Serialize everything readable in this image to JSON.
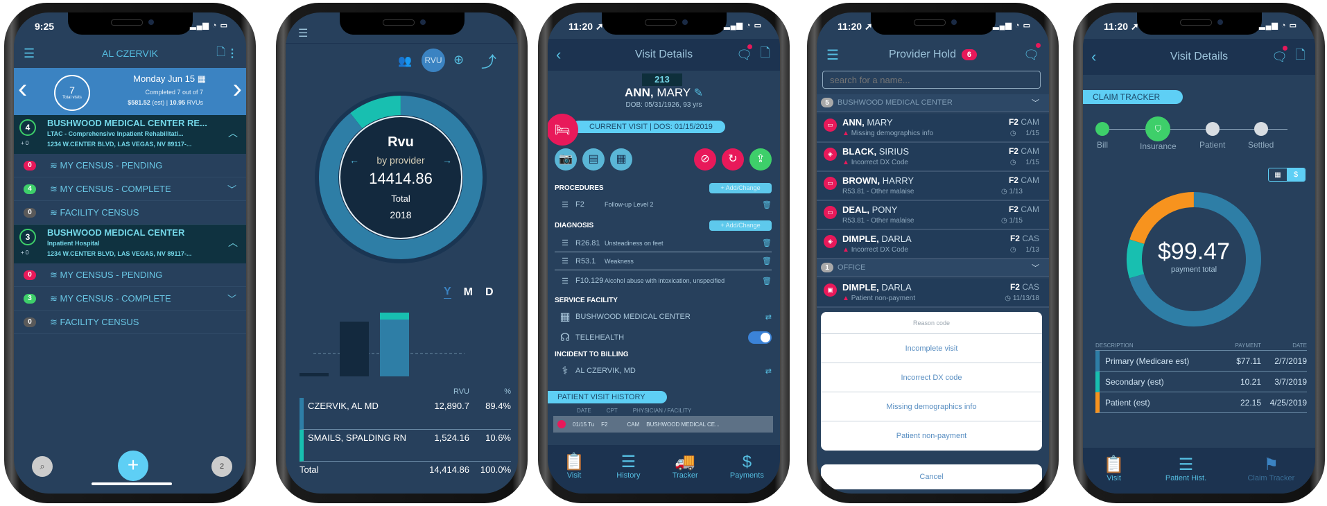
{
  "phone1": {
    "time": "9:25",
    "title": "AL CZERVIK",
    "hero": {
      "date": "Monday Jun 15",
      "visits_count": "7",
      "visits_label": "Total visits",
      "completed": "Completed 7 out of 7",
      "amount": "$581.52",
      "amount_suffix": "(est) |",
      "rvus": "10.95",
      "rvus_suffix": "RVUs"
    },
    "facilities": [
      {
        "count": "4",
        "plus": "+ 0",
        "name": "BUSHWOOD MEDICAL CENTER RE...",
        "type": "LTAC - Comprehensive Inpatient Rehabilitati...",
        "address": "1234 W.CENTER BLVD, LAS VEGAS, NV 89117-...",
        "items": [
          {
            "badge": "0",
            "label": "MY CENSUS - PENDING",
            "color": "#e8195a"
          },
          {
            "badge": "4",
            "label": "MY CENSUS - COMPLETE",
            "color": "#3ecf6a"
          },
          {
            "badge": "0",
            "label": "FACILITY CENSUS",
            "color": "#5a5a5a"
          }
        ]
      },
      {
        "count": "3",
        "plus": "+ 0",
        "name": "BUSHWOOD MEDICAL CENTER",
        "type": "Inpatient Hospital",
        "address": "1234 W.CENTER BLVD, LAS VEGAS, NV 89117-...",
        "items": [
          {
            "badge": "0",
            "label": "MY CENSUS - PENDING",
            "color": "#e8195a"
          },
          {
            "badge": "3",
            "label": "MY CENSUS - COMPLETE",
            "color": "#3ecf6a"
          },
          {
            "badge": "0",
            "label": "FACILITY CENSUS",
            "color": "#5a5a5a"
          }
        ]
      }
    ],
    "bottom_right_badge": "2"
  },
  "phone2": {
    "toggle_label": "RVU",
    "ring_title": "Rvu",
    "ring_subtitle": "by provider",
    "ring_value": "14414.86",
    "ring_caption": "Total",
    "ring_year": "2018",
    "periods": [
      "Y",
      "M",
      "D"
    ],
    "active_period": "Y",
    "table": {
      "headers": [
        "",
        "RVU",
        "%"
      ],
      "rows": [
        {
          "name": "CZERVIK, AL MD",
          "rvu": "12,890.7",
          "pct": "89.4%",
          "color": "#2e7ea6"
        },
        {
          "name": "SMAILS, SPALDING RN",
          "rvu": "1,524.16",
          "pct": "10.6%",
          "color": "#18bfb0"
        }
      ],
      "total": {
        "name": "Total",
        "rvu": "14,414.86",
        "pct": "100.0%"
      }
    }
  },
  "phone3": {
    "time": "11:20",
    "title": "Visit Details",
    "room": "213",
    "patient_last": "ANN,",
    "patient_first": "MARY",
    "dob": "DOB: 05/31/1926, 93 yrs",
    "current_visit": "CURRENT VISIT  |  DOS: 01/15/2019",
    "procedures_label": "PROCEDURES",
    "add_change": "+ Add/Change",
    "procedures": [
      {
        "code": "F2",
        "desc": "Follow-up Level 2"
      }
    ],
    "diagnosis_label": "DIAGNOSIS",
    "diagnoses": [
      {
        "code": "R26.81",
        "desc": "Unsteadiness on feet"
      },
      {
        "code": "R53.1",
        "desc": "Weakness"
      },
      {
        "code": "F10.129",
        "desc": "Alcohol abuse with intoxication, unspecified"
      }
    ],
    "service_facility_label": "SERVICE FACILITY",
    "facility": "BUSHWOOD MEDICAL CENTER",
    "telehealth": "TELEHEALTH",
    "telehealth_on": true,
    "incident_label": "INCIDENT TO BILLING",
    "provider": "AL CZERVIK, MD",
    "history_label": "PATIENT VISIT HISTORY",
    "history_headers": [
      "DATE",
      "CPT",
      "PHYSICIAN / FACILITY"
    ],
    "history_row": {
      "date": "01/15 Tu",
      "cpt": "F2",
      "phys": "CAM",
      "facility": "BUSHWOOD MEDICAL CE..."
    },
    "tabs": [
      "Visit",
      "History",
      "Tracker",
      "Payments"
    ]
  },
  "phone4": {
    "time": "11:20",
    "title": "Provider Hold",
    "count": "6",
    "search_placeholder": "search for a name...",
    "groups": [
      {
        "count": "5",
        "name": "BUSHWOOD MEDICAL CENTER",
        "rows": [
          {
            "last": "ANN,",
            "first": "MARY",
            "reason": "Missing demographics info",
            "warn": true,
            "cpt": "F2",
            "phys": "CAM",
            "date": "1/15"
          },
          {
            "last": "BLACK,",
            "first": "SIRIUS",
            "reason": "Incorrect DX Code",
            "warn": true,
            "cpt": "F2",
            "phys": "CAM",
            "date": "1/15"
          },
          {
            "last": "BROWN,",
            "first": "HARRY",
            "reason": "R53.81 - Other malaise",
            "warn": false,
            "cpt": "F2",
            "phys": "CAM",
            "date": "1/13"
          },
          {
            "last": "DEAL,",
            "first": "PONY",
            "reason": "R53.81 - Other malaise",
            "warn": false,
            "cpt": "F2",
            "phys": "CAM",
            "date": "1/15"
          },
          {
            "last": "DIMPLE,",
            "first": "DARLA",
            "reason": "Incorrect DX Code",
            "warn": true,
            "cpt": "F2",
            "phys": "CAS",
            "date": "1/13"
          }
        ]
      },
      {
        "count": "1",
        "name": "OFFICE",
        "rows": [
          {
            "last": "DIMPLE,",
            "first": "DARLA",
            "reason": "Patient non-payment",
            "warn": true,
            "cpt": "F2",
            "phys": "CAS",
            "date": "11/13/18"
          }
        ]
      }
    ],
    "sheet": {
      "title": "Reason code",
      "options": [
        "Incomplete visit",
        "Incorrect DX code",
        "Missing demographics info",
        "Patient non-payment"
      ],
      "cancel": "Cancel"
    }
  },
  "phone5": {
    "time": "11:20",
    "title": "Visit Details",
    "tracker_label": "CLAIM TRACKER",
    "steps": [
      {
        "label": "Bill",
        "done": true
      },
      {
        "label": "Insurance",
        "done": true,
        "current": true
      },
      {
        "label": "Patient",
        "done": false
      },
      {
        "label": "Settled",
        "done": false
      }
    ],
    "view_toggle": [
      "calendar",
      "$"
    ],
    "total": "$99.47",
    "total_caption": "payment total",
    "headers": [
      "DESCRIPTION",
      "PAYMENT",
      "DATE"
    ],
    "payments": [
      {
        "desc": "Primary (Medicare est)",
        "amount": "$77.11",
        "value": 77.11,
        "date": "2/7/2019",
        "color": "#2e7ea6"
      },
      {
        "desc": "Secondary (est)",
        "amount": "10.21",
        "value": 10.21,
        "date": "3/7/2019",
        "color": "#18bfb0"
      },
      {
        "desc": "Patient (est)",
        "amount": "22.15",
        "value": 22.15,
        "date": "4/25/2019",
        "color": "#f7931e"
      }
    ],
    "tabs": [
      "Visit",
      "Patient Hist.",
      "Claim Tracker"
    ]
  }
}
